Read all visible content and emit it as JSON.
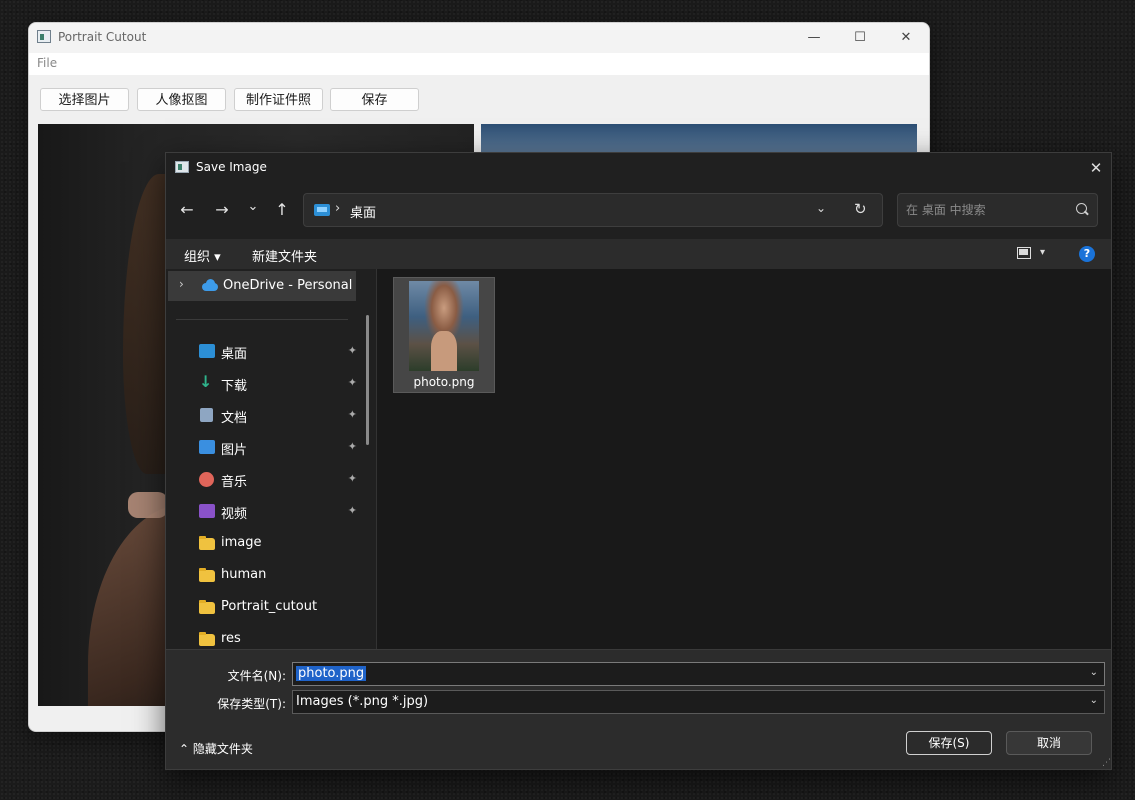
{
  "main_window": {
    "title": "Portrait Cutout",
    "menu": {
      "file": "File"
    },
    "toolbar": {
      "select_image": "选择图片",
      "portrait_cutout": "人像抠图",
      "make_id_photo": "制作证件照",
      "save": "保存"
    },
    "controls": {
      "minimize": "—",
      "maximize": "☐",
      "close": "✕"
    }
  },
  "dialog": {
    "title": "Save Image",
    "close": "✕",
    "nav": {
      "back": "←",
      "forward": "→",
      "recent": "⌄",
      "up": "↑"
    },
    "address": {
      "separator": "›",
      "location": "桌面",
      "dropdown": "⌄",
      "refresh": "↻"
    },
    "search": {
      "placeholder": "在 桌面 中搜索"
    },
    "commands": {
      "organize": "组织 ▾",
      "new_folder": "新建文件夹",
      "view_dropdown": "▾",
      "help": "?"
    },
    "nav_pane": {
      "onedrive": {
        "chevron": "›",
        "label": "OneDrive - Personal"
      },
      "items": [
        {
          "label": "桌面",
          "icon": "desktop-icon",
          "pinned": true,
          "color": "#2c8fd6"
        },
        {
          "label": "下载",
          "icon": "download-icon",
          "pinned": true,
          "color": "#2fb48c"
        },
        {
          "label": "文档",
          "icon": "document-icon",
          "pinned": true,
          "color": "#8ea6c2"
        },
        {
          "label": "图片",
          "icon": "pictures-icon",
          "pinned": true,
          "color": "#3a8fe0"
        },
        {
          "label": "音乐",
          "icon": "music-icon",
          "pinned": true,
          "color": "#e0655a"
        },
        {
          "label": "视频",
          "icon": "video-icon",
          "pinned": true,
          "color": "#8a52c9"
        },
        {
          "label": "image",
          "icon": "folder-icon",
          "pinned": false
        },
        {
          "label": "human",
          "icon": "folder-icon",
          "pinned": false
        },
        {
          "label": "Portrait_cutout",
          "icon": "folder-icon",
          "pinned": false
        },
        {
          "label": "res",
          "icon": "folder-icon",
          "pinned": false
        }
      ],
      "pin_glyph": "📌"
    },
    "files": [
      {
        "name": "photo.png"
      }
    ],
    "footer": {
      "filename_label": "文件名(N):",
      "filename_value": "photo.png",
      "filetype_label": "保存类型(T):",
      "filetype_value": "Images (*.png *.jpg)",
      "dropdown": "⌄",
      "hide_folders": "⌃ 隐藏文件夹",
      "save_button": "保存(S)",
      "cancel_button": "取消",
      "grip": "⋰"
    }
  }
}
